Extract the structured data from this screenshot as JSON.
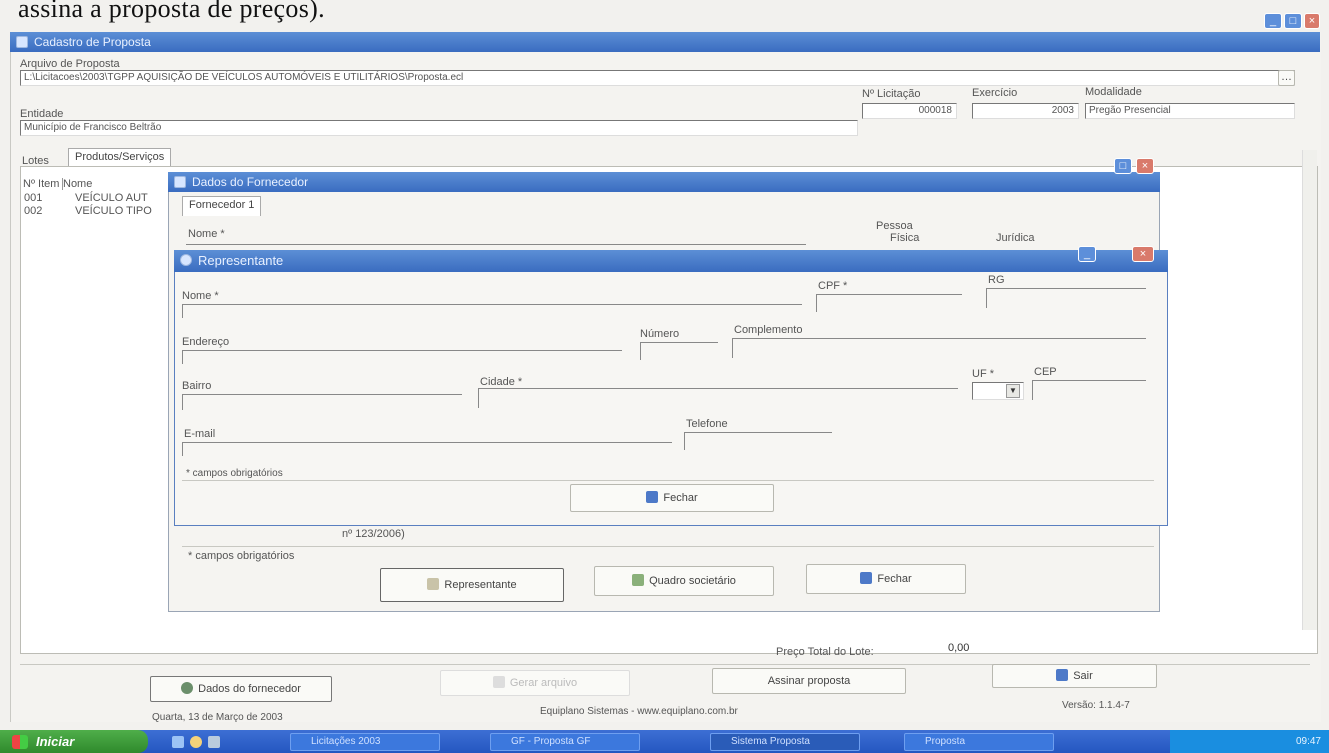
{
  "document_text": "assina a proposta de preços).",
  "main_window": {
    "title": "Cadastro de Proposta",
    "arquivo_label": "Arquivo de Proposta",
    "arquivo_value": "L:\\Licitacoes\\2003\\TGPP AQUISIÇÃO DE VEÍCULOS AUTOMÓVEIS E UTILITÁRIOS\\Proposta.ecl",
    "num_licitacao_label": "Nº Licitação",
    "num_licitacao_value": "000018",
    "exercicio_label": "Exercício",
    "exercicio_value": "2003",
    "modalidade_label": "Modalidade",
    "modalidade_value": "Pregão Presencial",
    "entidade_label": "Entidade",
    "entidade_value": "Município de Francisco Beltrão",
    "tabs": [
      "Lotes",
      "Produtos/Serviços"
    ],
    "grid_headers": [
      "Nº Item",
      "Nome"
    ],
    "grid_rows": [
      {
        "item": "001",
        "nome": "VEÍCULO AUT"
      },
      {
        "item": "002",
        "nome": "VEÍCULO TIPO"
      }
    ],
    "preco_total_label": "Preço Total do Lote:",
    "preco_total_value": "0,00",
    "dados_button": "Dados do fornecedor",
    "disabled_button": "Gerar arquivo",
    "assinar_button": "Assinar proposta",
    "sair_button": "Sair",
    "status_date": "Quarta, 13 de Março de 2003",
    "status_company": "Equiplano Sistemas - www.equiplano.com.br",
    "status_version": "Versão: 1.1.4-7"
  },
  "fornecedor_window": {
    "title": "Dados do Fornecedor",
    "tab": "Fornecedor 1",
    "nome_label": "Nome *",
    "pessoa_label": "Pessoa",
    "pessoa_options": [
      "Física",
      "Jurídica"
    ],
    "lei_text": "nº 123/2006)",
    "obrigatorios": "* campos obrigatórios",
    "representante_button": "Representante",
    "quadro_button": "Quadro societário",
    "fechar_button": "Fechar"
  },
  "representante_window": {
    "title": "Representante",
    "nome_label": "Nome *",
    "cpf_label": "CPF *",
    "rg_label": "RG",
    "endereco_label": "Endereço",
    "numero_label": "Número",
    "complemento_label": "Complemento",
    "bairro_label": "Bairro",
    "cidade_label": "Cidade *",
    "uf_label": "UF *",
    "cep_label": "CEP",
    "email_label": "E-mail",
    "telefone_label": "Telefone",
    "obrigatorios": "* campos obrigatórios",
    "fechar_button": "Fechar"
  },
  "taskbar": {
    "start_label": "Iniciar",
    "items": [
      "Licitações 2003",
      "GF - Proposta GF",
      "Sistema Proposta",
      "Proposta"
    ],
    "clock": "09:47"
  },
  "colors": {
    "titlebar": "#3a6cc0",
    "taskbar": "#2456c0",
    "start_button": "#2f8a2c",
    "close_button": "#d97a6b"
  }
}
